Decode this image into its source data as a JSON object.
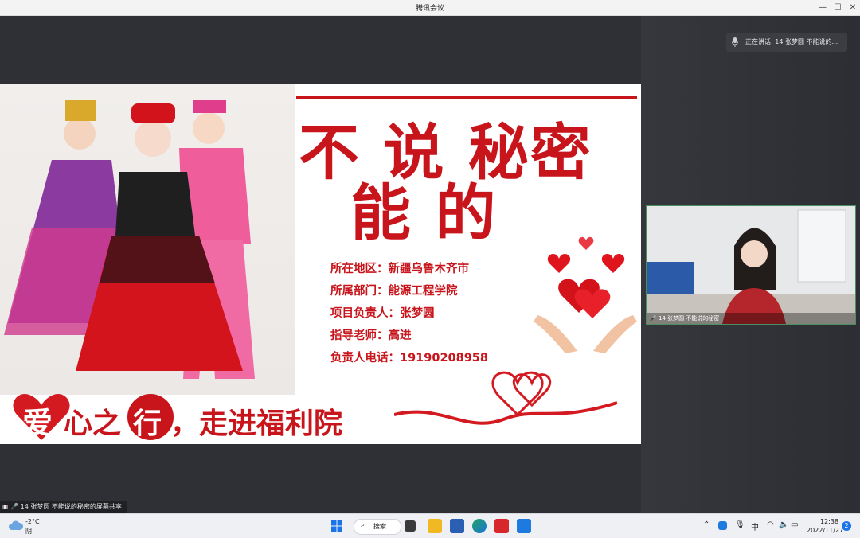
{
  "window": {
    "title": "腾讯会议",
    "minimize": "—",
    "maximize": "☐",
    "close": "✕"
  },
  "speaking": {
    "text": "正在讲话: 14 张梦圆 不能说的..."
  },
  "slide": {
    "title_line1": "不 说 秘密",
    "title_line2": "能 的",
    "info": [
      "所在地区：新疆乌鲁木齐市",
      "所属部门：能源工程学院",
      "项目负责人：张梦圆",
      "指导老师：高进",
      "负责人电话：19190208958"
    ],
    "banner_text_a": "爱",
    "banner_text_b": "心之",
    "banner_text_c": "行",
    "banner_text_d": "，走进福利院"
  },
  "video": {
    "label": "14 张梦圆 不能说的秘密"
  },
  "share_label": "14 张梦圆 不能说的秘密的屏幕共享",
  "taskbar": {
    "weather_temp": "-2°C",
    "weather_desc": "阴",
    "search_label": "搜索",
    "ime": "中",
    "time": "12:38",
    "date": "2022/11/27",
    "notif_count": "2"
  },
  "colors": {
    "accent_red": "#c8151c",
    "taskbar_bg": "#eef0f4"
  },
  "icons": [
    "mic-icon",
    "windows-start-icon",
    "search-icon",
    "taskview-icon",
    "file-explorer-icon",
    "word-icon",
    "edge-icon",
    "wps-icon",
    "tencent-meeting-icon",
    "wifi-icon",
    "volume-icon",
    "battery-icon",
    "chevron-up-icon",
    "cloud-icon"
  ]
}
